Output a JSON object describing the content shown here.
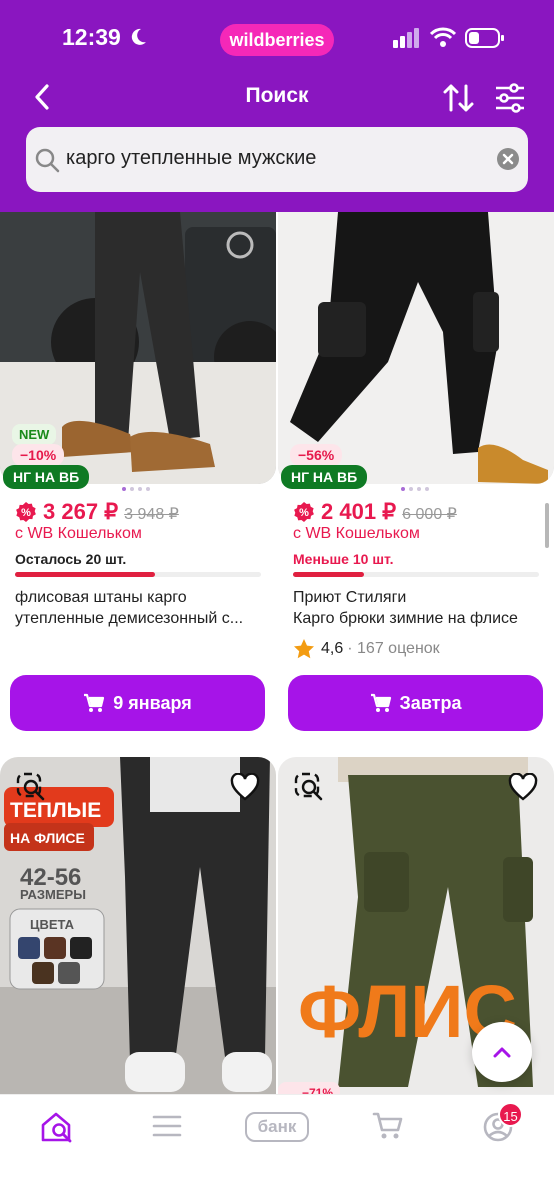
{
  "status": {
    "time": "12:39",
    "logo": "wildberries"
  },
  "header": {
    "title": "Поиск",
    "back_icon": "chevron-left-icon",
    "sort_icon": "sort-icon",
    "filter_icon": "filter-icon"
  },
  "search": {
    "value": "карго утепленные мужские",
    "icon": "search-icon",
    "clear_icon": "clear-icon"
  },
  "products": [
    {
      "badge_new": "NEW",
      "discount": "−10%",
      "promo": "НГ НА ВБ",
      "price": "3 267 ₽",
      "old_price": "3 948 ₽",
      "wallet": "с WB Кошельком",
      "stock": "Осталось 20 шт.",
      "stock_level": 0.57,
      "stock_color": "#222222",
      "name": "флисовая штаны карго",
      "desc": "утепленные демисезонный с...",
      "delivery": "9 января"
    },
    {
      "discount": "−56%",
      "promo": "НГ НА ВБ",
      "price": "2 401 ₽",
      "old_price": "6 000 ₽",
      "wallet": "с WB Кошельком",
      "stock": "Меньше 10 шт.",
      "stock_level": 0.29,
      "stock_color": "#e8194f",
      "brand": "Приют Стиляги",
      "desc": "Карго брюки зимние на флисе",
      "rating": "4,6",
      "reviews": "· 167 оценок",
      "delivery": "Завтра"
    }
  ],
  "next_products": [
    {
      "banner_title": "ТЕПЛЫЕ",
      "banner_sub": "НА ФЛИСЕ",
      "sizes": "42-56",
      "sizes_label": "РАЗМЕРЫ",
      "colors_label": "ЦВЕТА"
    },
    {
      "banner": "ФЛИС",
      "discount": "−71%"
    }
  ],
  "bottom_nav": {
    "bank": "банк",
    "cart_count": "15"
  },
  "colors": {
    "brand": "#8a16c0",
    "button": "#a614e8",
    "price": "#e8194f",
    "promo": "#0f7a24"
  }
}
